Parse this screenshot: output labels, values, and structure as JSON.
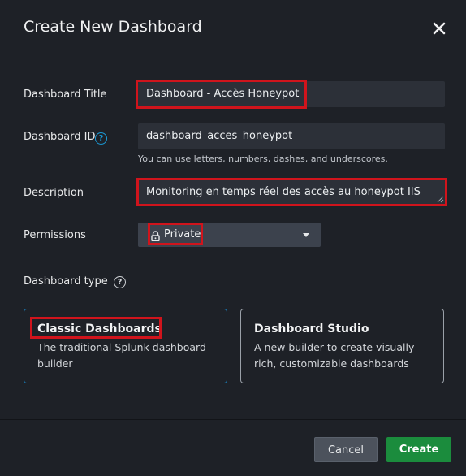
{
  "modal": {
    "title": "Create New Dashboard",
    "close_icon": "close-icon"
  },
  "form": {
    "title_label": "Dashboard Title",
    "title_value": "Dashboard - Accès Honeypot",
    "id_label": "Dashboard ID",
    "id_value": "dashboard_acces_honeypot",
    "id_hint": "You can use letters, numbers, dashes, and underscores.",
    "description_label": "Description",
    "description_value": "Monitoring en temps réel des accès au honeypot IIS",
    "permissions_label": "Permissions",
    "permissions_value": "Private",
    "dashboard_type_label": "Dashboard type",
    "help_glyph": "?"
  },
  "dashboard_types": [
    {
      "title": "Classic Dashboards",
      "description": "The traditional Splunk dashboard builder",
      "selected": true
    },
    {
      "title": "Dashboard Studio",
      "description": "A new builder to create visually-rich, customizable dashboards",
      "selected": false
    }
  ],
  "footer": {
    "cancel_label": "Cancel",
    "create_label": "Create"
  },
  "colors": {
    "background": "#1e2127",
    "input_background": "#2c3038",
    "highlight_red": "#d0141c",
    "accent_blue": "#1a9cd9",
    "create_green": "#1b8c3d"
  }
}
